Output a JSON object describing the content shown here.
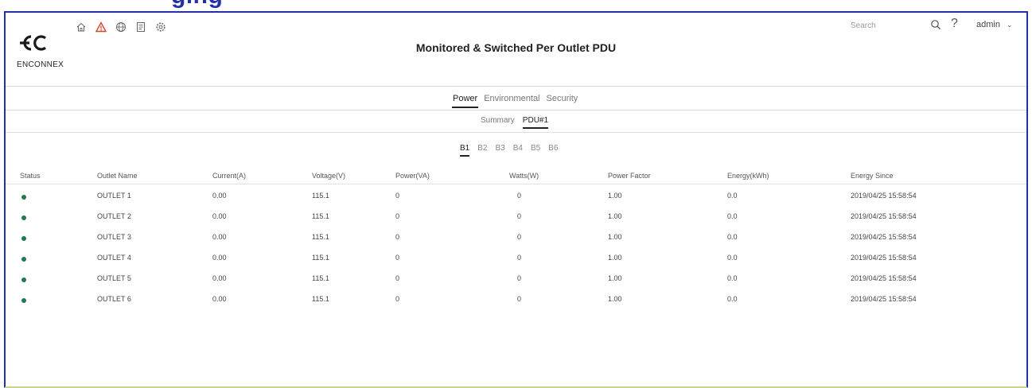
{
  "app": {
    "banner_fragment": "ging",
    "title": "Monitored & Switched Per Outlet PDU",
    "logo_text": "ENCONNEX"
  },
  "toolbar": {
    "icons": [
      "home-icon",
      "alert-icon",
      "globe-icon",
      "document-icon",
      "settings-icon"
    ]
  },
  "search": {
    "placeholder": "Search"
  },
  "user": {
    "name": "admin"
  },
  "colors": {
    "frame": "#2330a8",
    "alert": "#d9442b",
    "status_ok": "#1f7a4d",
    "banner_text": "#2330a8"
  },
  "tabs": [
    {
      "label": "Power",
      "active": true
    },
    {
      "label": "Environmental",
      "active": false
    },
    {
      "label": "Security",
      "active": false
    }
  ],
  "subtabs": [
    {
      "label": "Summary",
      "active": false
    },
    {
      "label": "PDU#1",
      "active": true
    }
  ],
  "banks": [
    {
      "label": "B1",
      "active": true
    },
    {
      "label": "B2",
      "active": false
    },
    {
      "label": "B3",
      "active": false
    },
    {
      "label": "B4",
      "active": false
    },
    {
      "label": "B5",
      "active": false
    },
    {
      "label": "B6",
      "active": false
    }
  ],
  "table": {
    "columns": [
      "Status",
      "Outlet Name",
      "Current(A)",
      "Voltage(V)",
      "Power(VA)",
      "Watts(W)",
      "Power Factor",
      "Energy(kWh)",
      "Energy Since"
    ],
    "rows": [
      {
        "name": "OUTLET 1",
        "current": "0.00",
        "voltage": "115.1",
        "power_va": "0",
        "watts": "0",
        "pf": "1.00",
        "energy": "0.0",
        "since": "2019/04/25 15:58:54"
      },
      {
        "name": "OUTLET 2",
        "current": "0.00",
        "voltage": "115.1",
        "power_va": "0",
        "watts": "0",
        "pf": "1.00",
        "energy": "0.0",
        "since": "2019/04/25 15:58:54"
      },
      {
        "name": "OUTLET 3",
        "current": "0.00",
        "voltage": "115.1",
        "power_va": "0",
        "watts": "0",
        "pf": "1.00",
        "energy": "0.0",
        "since": "2019/04/25 15:58:54"
      },
      {
        "name": "OUTLET 4",
        "current": "0.00",
        "voltage": "115.1",
        "power_va": "0",
        "watts": "0",
        "pf": "1.00",
        "energy": "0.0",
        "since": "2019/04/25 15:58:54"
      },
      {
        "name": "OUTLET 5",
        "current": "0.00",
        "voltage": "115.1",
        "power_va": "0",
        "watts": "0",
        "pf": "1.00",
        "energy": "0.0",
        "since": "2019/04/25 15:58:54"
      },
      {
        "name": "OUTLET 6",
        "current": "0.00",
        "voltage": "115.1",
        "power_va": "0",
        "watts": "0",
        "pf": "1.00",
        "energy": "0.0",
        "since": "2019/04/25 15:58:54"
      }
    ]
  }
}
